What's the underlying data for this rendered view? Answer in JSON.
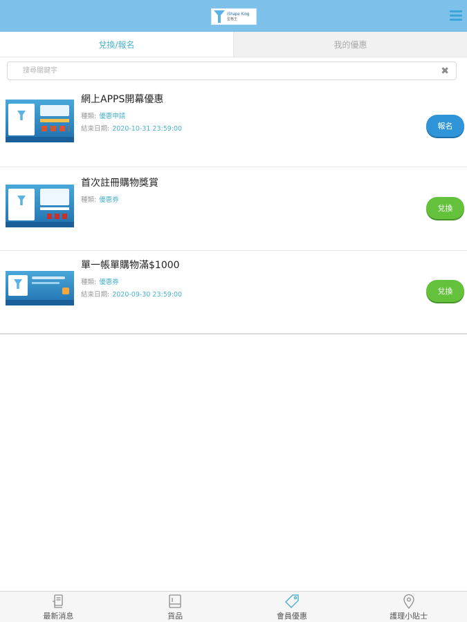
{
  "header": {
    "logo_text": "iShape King",
    "logo_subtext": "型格王",
    "menu_icon": "hamburger-menu-icon"
  },
  "tabs": [
    {
      "label": "兌換/報名",
      "active": true
    },
    {
      "label": "我的優惠",
      "active": false
    }
  ],
  "search": {
    "placeholder": "搜尋關鍵字",
    "value": ""
  },
  "items": [
    {
      "title": "網上APPS開幕優惠",
      "type_label": "種類:",
      "type_value": "優惠申請",
      "end_label": "結束日期:",
      "end_value": "2020-10-31 23:59:00",
      "button_label": "報名",
      "button_color": "#2f95d8"
    },
    {
      "title": "首次註冊購物獎賞",
      "type_label": "種類:",
      "type_value": "優惠券",
      "button_label": "兌換",
      "button_color": "#63c13c"
    },
    {
      "title": "單一帳單購物滿$1000",
      "type_label": "種類:",
      "type_value": "優惠券",
      "end_label": "結束日期:",
      "end_value": "2020-09-30 23:59:00",
      "button_label": "兌換",
      "button_color": "#63c13c"
    }
  ],
  "bottom_nav": [
    {
      "label": "最新消息",
      "icon": "news-icon"
    },
    {
      "label": "貨品",
      "icon": "product-icon"
    },
    {
      "label": "會員優惠",
      "icon": "tag-icon",
      "active": true
    },
    {
      "label": "護理小貼士",
      "icon": "location-pin-icon"
    }
  ],
  "colors": {
    "header_bg": "#7dc1ea",
    "accent": "#4ab0cf",
    "blue_button": "#2f95d8",
    "green_button": "#63c13c"
  }
}
